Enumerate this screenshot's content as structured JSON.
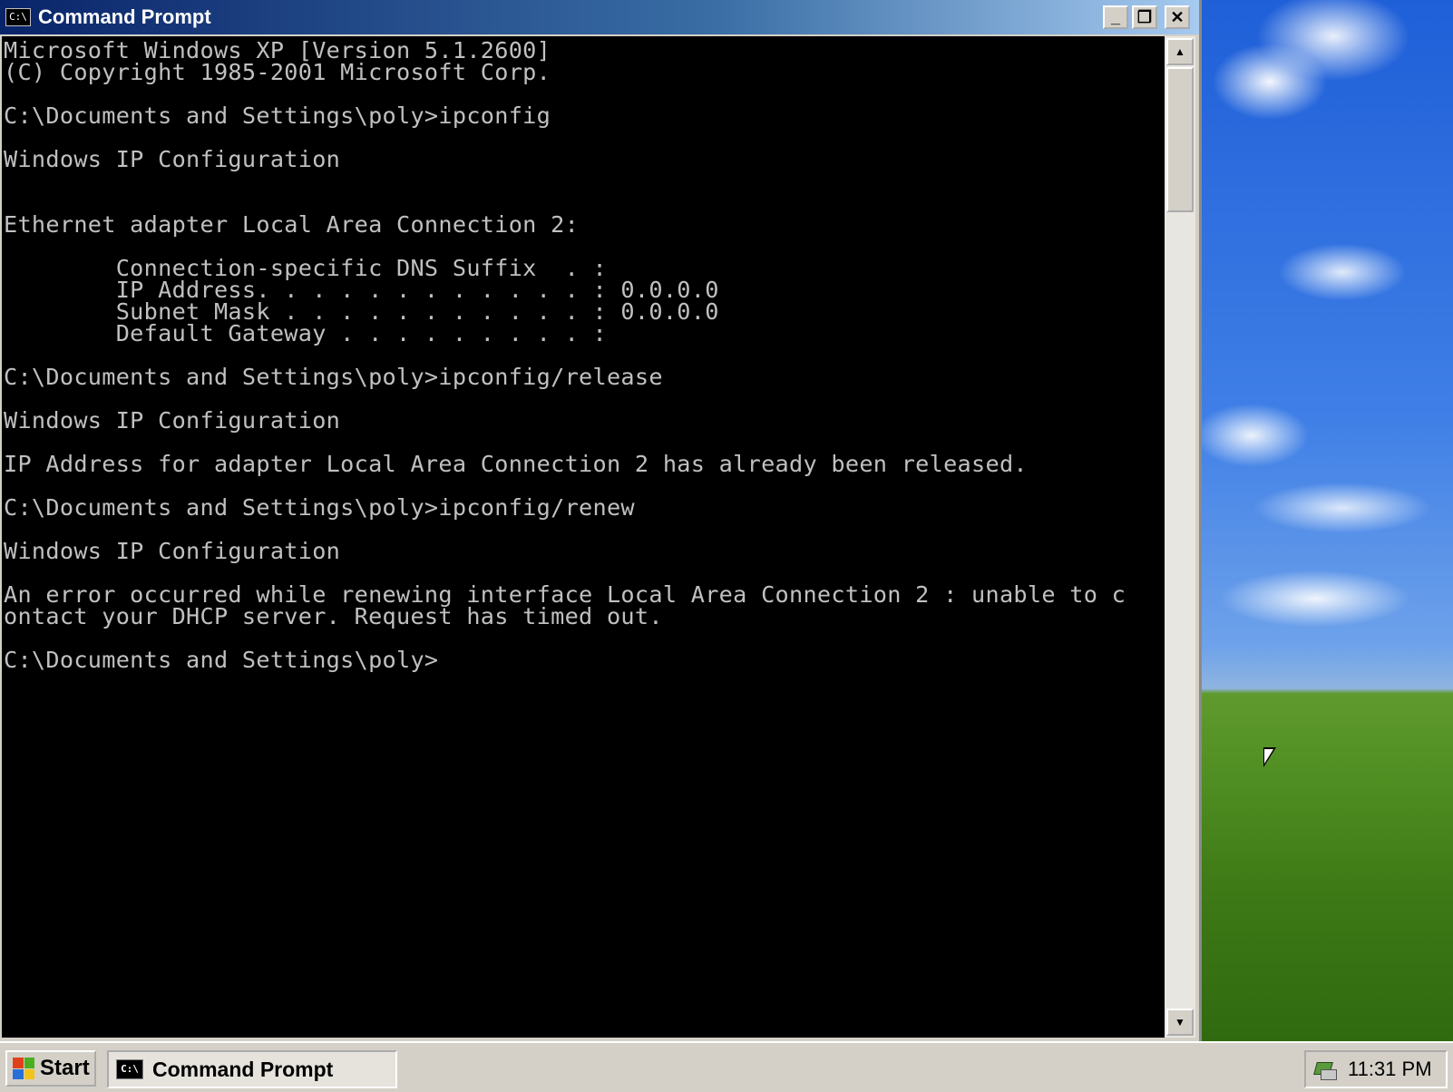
{
  "window": {
    "title": "Command Prompt",
    "icon": "console-icon",
    "controls": {
      "minimize": "minimize-icon",
      "restore": "restore-icon",
      "close": "close-icon"
    }
  },
  "console": {
    "lines": [
      "Microsoft Windows XP [Version 5.1.2600]",
      "(C) Copyright 1985-2001 Microsoft Corp.",
      "",
      "C:\\Documents and Settings\\poly>ipconfig",
      "",
      "Windows IP Configuration",
      "",
      "",
      "Ethernet adapter Local Area Connection 2:",
      "",
      "        Connection-specific DNS Suffix  . :",
      "        IP Address. . . . . . . . . . . . : 0.0.0.0",
      "        Subnet Mask . . . . . . . . . . . : 0.0.0.0",
      "        Default Gateway . . . . . . . . . :",
      "",
      "C:\\Documents and Settings\\poly>ipconfig/release",
      "",
      "Windows IP Configuration",
      "",
      "IP Address for adapter Local Area Connection 2 has already been released.",
      "",
      "C:\\Documents and Settings\\poly>ipconfig/renew",
      "",
      "Windows IP Configuration",
      "",
      "An error occurred while renewing interface Local Area Connection 2 : unable to c",
      "ontact your DHCP server. Request has timed out.",
      "",
      "C:\\Documents and Settings\\poly>"
    ]
  },
  "scrollbar": {
    "up_arrow": "▲",
    "down_arrow": "▼"
  },
  "taskbar": {
    "start_label": "Start",
    "task_button_label": "Command Prompt",
    "tray_icon": "network-icon",
    "clock": "11:31 PM"
  }
}
